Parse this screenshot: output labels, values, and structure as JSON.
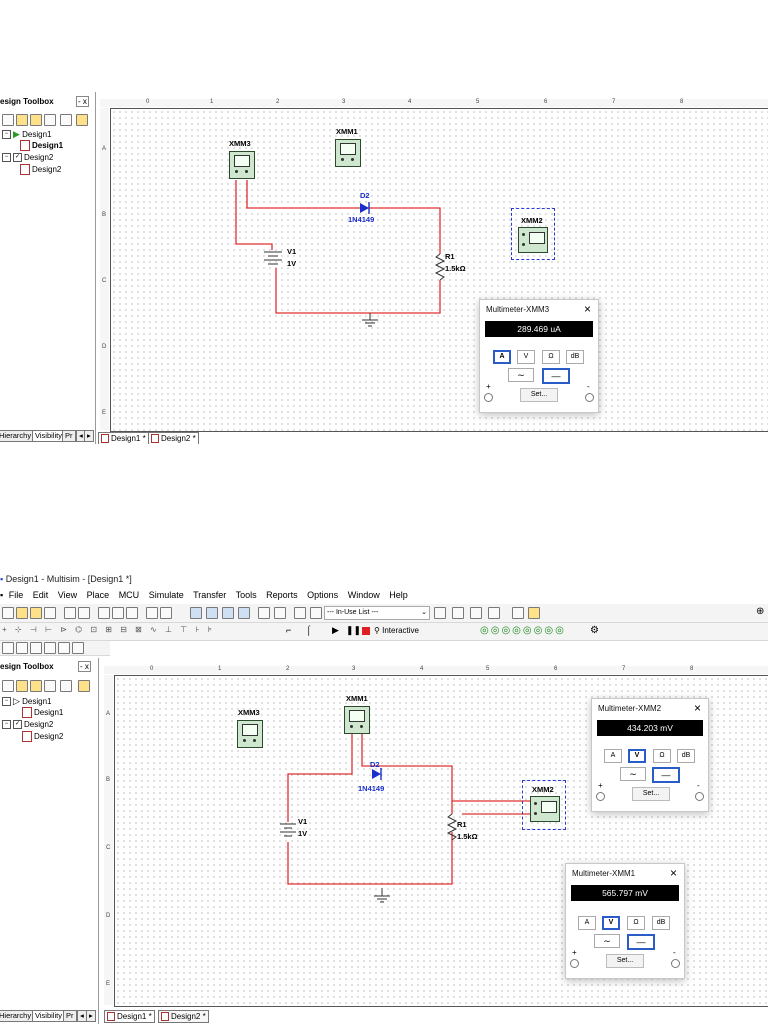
{
  "top": {
    "panel": {
      "title": "esign Toolbox",
      "min_close": "- x",
      "tree": [
        {
          "label": "Design1"
        },
        {
          "label": "Design1"
        },
        {
          "label": "Design2"
        },
        {
          "label": "Design2"
        }
      ],
      "tabs": [
        "Hierarchy",
        "Visibility",
        "Pr"
      ]
    },
    "sheet_tabs": [
      "Design1 *",
      "Design2 *"
    ],
    "ruler_top": [
      "0",
      "1",
      "2",
      "3",
      "4",
      "5",
      "6",
      "7",
      "8"
    ],
    "ruler_left": [
      "A",
      "B",
      "C",
      "D",
      "E"
    ],
    "components": {
      "xmm3": "XMM3",
      "xmm1": "XMM1",
      "xmm2": "XMM2",
      "d2_name": "D2",
      "d2_model": "1N4149",
      "v1_name": "V1",
      "v1_value": "1V",
      "r1_name": "R1",
      "r1_value": "1.5kΩ"
    },
    "multimeter": {
      "title": "Multimeter-XMM3",
      "close": "×",
      "reading": "289.469 uA",
      "modes": [
        "A",
        "V",
        "Ω",
        "dB"
      ],
      "selected_mode": "A",
      "ac_symbol": "∼",
      "dc_symbol": "―",
      "selected_coupling": "DC",
      "plus": "+",
      "minus": "-",
      "set_label": "Set..."
    }
  },
  "bottom": {
    "window_title": "Design1 - Multisim - [Design1 *]",
    "menu": [
      "File",
      "Edit",
      "View",
      "Place",
      "MCU",
      "Simulate",
      "Transfer",
      "Tools",
      "Reports",
      "Options",
      "Window",
      "Help"
    ],
    "in_use_list": "--- In-Use List ---",
    "interactive_label": "Interactive",
    "panel": {
      "title": "esign Toolbox",
      "min_close": "- x",
      "tree": [
        {
          "label": "Design1"
        },
        {
          "label": "Design1"
        },
        {
          "label": "Design2"
        },
        {
          "label": "Design2"
        }
      ],
      "tabs": [
        "Hierarchy",
        "Visibility",
        "Pr"
      ]
    },
    "sheet_tabs": [
      "Design1 *",
      "Design2 *"
    ],
    "ruler_top": [
      "0",
      "1",
      "2",
      "3",
      "4",
      "5",
      "6",
      "7",
      "8"
    ],
    "ruler_left": [
      "A",
      "B",
      "C",
      "D",
      "E"
    ],
    "components": {
      "xmm3": "XMM3",
      "xmm1": "XMM1",
      "xmm2": "XMM2",
      "d2_name": "D2",
      "d2_model": "1N4149",
      "v1_name": "V1",
      "v1_value": "1V",
      "r1_name": "R1",
      "r1_value": "1.5kΩ"
    },
    "multimeter_xmm2": {
      "title": "Multimeter-XMM2",
      "close": "×",
      "reading": "434.203 mV",
      "modes": [
        "A",
        "V",
        "Ω",
        "dB"
      ],
      "selected_mode": "V",
      "ac_symbol": "∼",
      "dc_symbol": "―",
      "selected_coupling": "DC",
      "plus": "+",
      "minus": "-",
      "set_label": "Set..."
    },
    "multimeter_xmm1": {
      "title": "Multimeter-XMM1",
      "close": "×",
      "reading": "565.797 mV",
      "modes": [
        "A",
        "V",
        "Ω",
        "dB"
      ],
      "selected_mode": "V",
      "ac_symbol": "∼",
      "dc_symbol": "―",
      "selected_coupling": "DC",
      "plus": "+",
      "minus": "-",
      "set_label": "Set..."
    }
  },
  "colors": {
    "wire": "#e03030",
    "component_label": "#1a2fcc",
    "selection": "#2a5cc8",
    "meter_body": "#cfe7cf",
    "display_bg": "#000000"
  }
}
